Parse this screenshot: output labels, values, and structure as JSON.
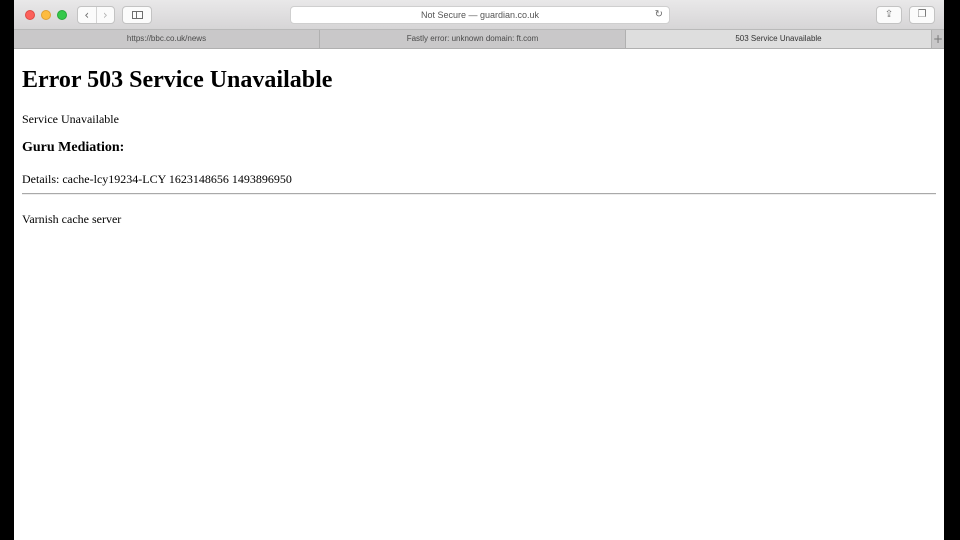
{
  "browser": {
    "address_text": "Not Secure — guardian.co.uk",
    "tabs": [
      {
        "label": "https://bbc.co.uk/news",
        "active": false
      },
      {
        "label": "Fastly error: unknown domain: ft.com",
        "active": false
      },
      {
        "label": "503 Service Unavailable",
        "active": true
      }
    ],
    "new_tab_label": "+",
    "icons": {
      "back": "‹",
      "forward": "›",
      "reload": "↻",
      "share": "⇪",
      "tabs_overview": "❐"
    }
  },
  "page": {
    "heading": "Error 503 Service Unavailable",
    "message": "Service Unavailable",
    "subheading": "Guru Mediation:",
    "details": "Details: cache-lcy19234-LCY 1623148656 1493896950",
    "footer": "Varnish cache server"
  }
}
